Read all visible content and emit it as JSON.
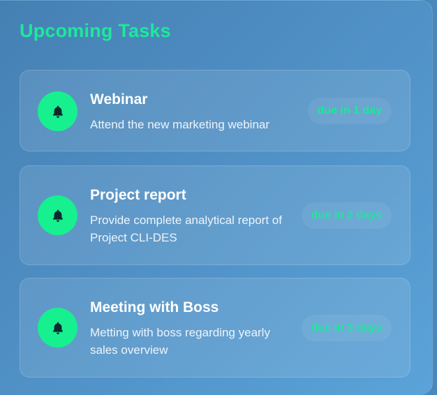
{
  "panel": {
    "title": "Upcoming Tasks"
  },
  "tasks": [
    {
      "icon": "bell-icon",
      "title": "Webinar",
      "description": "Attend the new marketing webinar",
      "due": "due in 1 day"
    },
    {
      "icon": "bell-icon",
      "title": "Project report",
      "description": "Provide complete analytical report of Project CLI-DES",
      "due": "due in 2 days"
    },
    {
      "icon": "bell-icon",
      "title": "Meeting with Boss",
      "description": "Metting with boss regarding yearly sales overview",
      "due": "due in 3 days"
    }
  ],
  "colors": {
    "accent": "#1de89a",
    "icon_background": "#17f08f",
    "icon_foreground": "#0f2a2e",
    "card_text": "#ffffff"
  }
}
